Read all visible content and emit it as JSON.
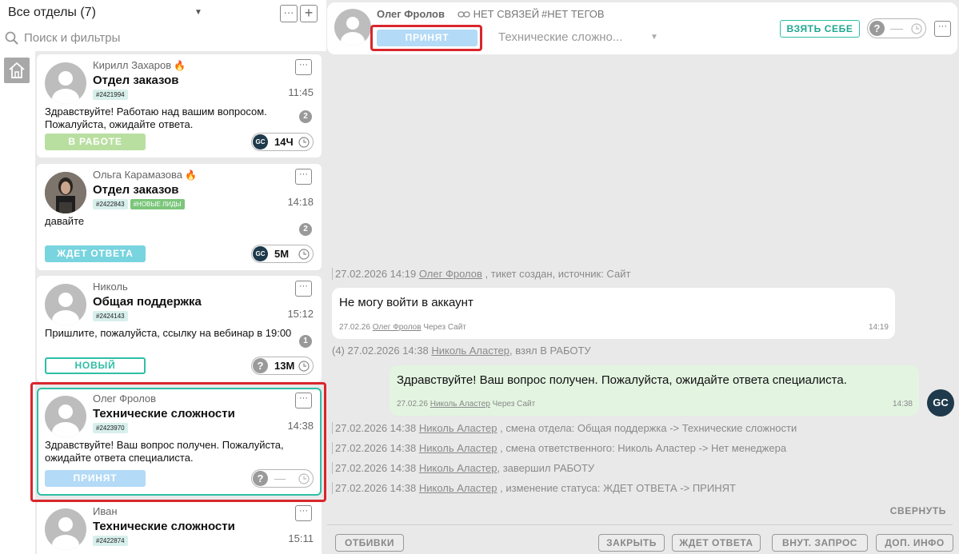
{
  "sidebar": {
    "department_select": "Все отделы (7)",
    "more_label": "···",
    "add_label": "+",
    "search_placeholder": "Поиск и фильтры"
  },
  "tickets": [
    {
      "name": "Кирилл Захаров",
      "fire": "🔥",
      "dept": "Отдел заказов",
      "time": "11:45",
      "tags": [
        "#2421994"
      ],
      "message": "Здравствуйте! Работаю над вашим вопросом. Пожалуйста, ожидайте ответа.",
      "unread": "2",
      "status": "В РАБОТЕ",
      "assignee": "GC",
      "timer": "14Ч"
    },
    {
      "name": "Ольга Карамазова",
      "fire": "🔥",
      "dept": "Отдел заказов",
      "time": "14:18",
      "tags": [
        "#2422843",
        "#НОВЫЕ ЛИДЫ"
      ],
      "message": "давайте",
      "unread": "2",
      "status": "ЖДЕТ ОТВЕТА",
      "assignee": "GC",
      "timer": "5М"
    },
    {
      "name": "Николь",
      "dept": "Общая поддержка",
      "time": "15:12",
      "tags": [
        "#2424143"
      ],
      "message": "Пришлите, пожалуйста, ссылку на вебинар в 19:00",
      "unread": "1",
      "status": "НОВЫЙ",
      "assignee": "?",
      "timer": "13М"
    },
    {
      "name": "Олег Фролов",
      "dept": "Технические сложности",
      "time": "14:38",
      "tags": [
        "#2423970"
      ],
      "message": "Здравствуйте! Ваш вопрос получен. Пожалуйста, ожидайте ответа специалиста.",
      "status": "ПРИНЯТ",
      "assignee": "?",
      "timer": ""
    },
    {
      "name": "Иван",
      "dept": "Технические сложности",
      "time": "15:11",
      "tags": [
        "#2422874"
      ]
    }
  ],
  "header": {
    "name": "Олег Фролов",
    "links": "НЕТ СВЯЗЕЙ",
    "tags": "#НЕТ ТЕГОВ",
    "status": "ПРИНЯТ",
    "department": "Технические сложно...",
    "take_button": "ВЗЯТЬ СЕБЕ",
    "timer_icon": "?",
    "more_label": "···"
  },
  "chat": {
    "events": [
      {
        "date": "27.02.2026 14:19",
        "user": "Олег Фролов",
        "text": ", тикет создан, источник: Сайт"
      },
      {
        "prefix": "(4)",
        "date": "27.02.2026 14:38",
        "user": "Николь Аластер",
        "text": ", взял В РАБОТУ"
      },
      {
        "date": "27.02.2026 14:38",
        "user": "Николь Аластер",
        "text": ", смена отдела: Общая поддержка -> Технические сложности"
      },
      {
        "date": "27.02.2026 14:38",
        "user": "Николь Аластер",
        "text": ", смена ответственного: Николь Аластер -> Нет менеджера"
      },
      {
        "date": "27.02.2026 14:38",
        "user": "Николь Аластер",
        "text": ", завершил РАБОТУ"
      },
      {
        "date": "27.02.2026 14:38",
        "user": "Николь Аластер",
        "text": ", изменение статуса: ЖДЕТ ОТВЕТА -> ПРИНЯТ"
      }
    ],
    "incoming": {
      "text": "Не могу войти в аккаунт",
      "date": "27.02.26",
      "user": "Олег Фролов",
      "via": "Через Сайт",
      "time": "14:19"
    },
    "outgoing": {
      "text": "Здравствуйте! Ваш вопрос получен. Пожалуйста, ожидайте ответа специалиста.",
      "date": "27.02.26",
      "user": "Николь Аластер",
      "via": "Через Сайт",
      "time": "14:38",
      "avatar": "GC"
    },
    "collapse": "СВЕРНУТЬ"
  },
  "actions": {
    "otbivki": "ОТБИВКИ",
    "close": "ЗАКРЫТЬ",
    "wait": "ЖДЕТ ОТВЕТА",
    "internal": "ВНУТ. ЗАПРОС",
    "extra": "ДОП. ИНФО"
  },
  "colors": {
    "accent": "#2fbfa5",
    "highlight": "#d9262c",
    "accepted": "#b3daf6"
  }
}
